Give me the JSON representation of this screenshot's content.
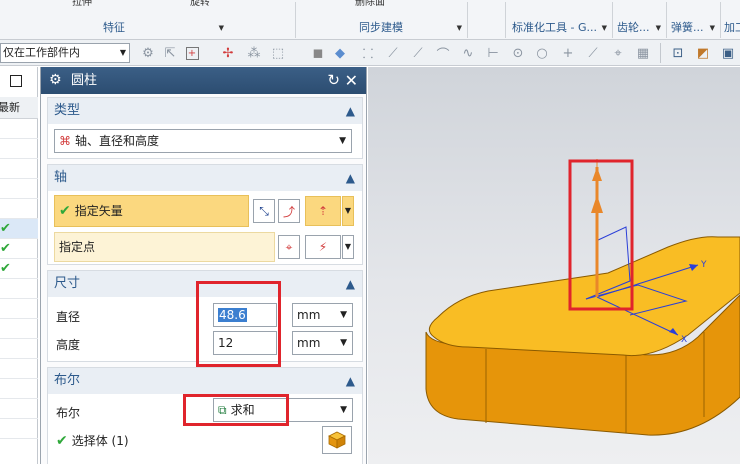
{
  "ribbon": {
    "groups": [
      {
        "label": "特征"
      },
      {
        "label": "同步建模"
      },
      {
        "label": "标准化工具 - G..."
      },
      {
        "label": "齿轮..."
      },
      {
        "label": "弹簧..."
      },
      {
        "label": "加工"
      }
    ],
    "partial_buttons": [
      "拉伸",
      "旋转",
      "删除面"
    ]
  },
  "toolbar": {
    "scope_value": "仅在工作部件内"
  },
  "navigator": {
    "header": "最新"
  },
  "dialog": {
    "title": "圆柱",
    "type": {
      "header": "类型",
      "value": "轴、直径和高度"
    },
    "axis": {
      "header": "轴",
      "specify_vector": "指定矢量",
      "specify_point": "指定点"
    },
    "dims": {
      "header": "尺寸",
      "diameter_label": "直径",
      "diameter_value": "48.6",
      "diameter_unit": "mm",
      "height_label": "高度",
      "height_value": "12",
      "height_unit": "mm"
    },
    "boolean": {
      "header": "布尔",
      "label": "布尔",
      "value": "求和",
      "select_body": "选择体 (1)"
    }
  },
  "graphics": {
    "axis_labels": {
      "y": "Y",
      "x": "X"
    }
  },
  "colors": {
    "part_top": "#f9bd24",
    "part_side": "#e6950a",
    "vector": "#e9872a",
    "highlight_box": "#e0242c",
    "title_bar": "#33577d",
    "check": "#2fa83a"
  }
}
